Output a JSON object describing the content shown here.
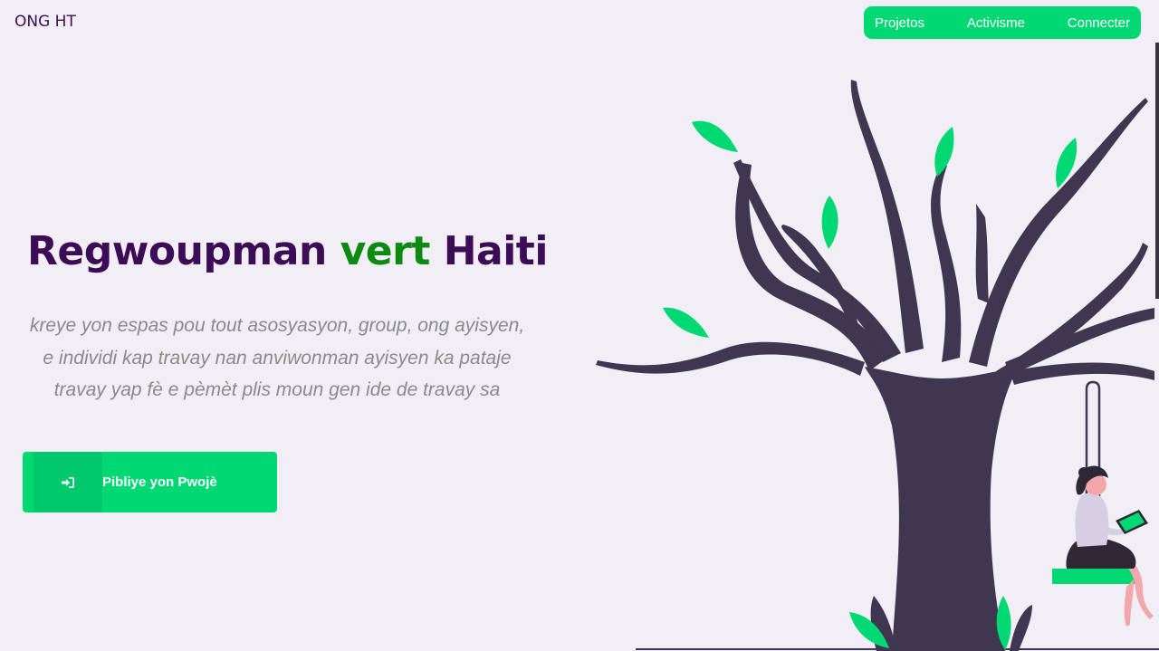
{
  "header": {
    "brand": "ONG HT",
    "nav": [
      {
        "label": "Projetos"
      },
      {
        "label": "Activisme"
      },
      {
        "label": "Connecter"
      }
    ]
  },
  "hero": {
    "title_part1": "Regwoupman ",
    "title_accent": "vert",
    "title_part2": " Haiti",
    "subtitle": "kreye yon espas pou tout asosyasyon, group, ong ayisyen, e individi kap travay nan anviwonman ayisyen ka pataje travay yap fè e pèmèt plis moun gen ide de travay sa",
    "cta_label": "Pibliye yon Pwojè",
    "cta_icon": "sign-in-icon"
  },
  "colors": {
    "background": "#f1eff5",
    "brand_text": "#3c0d56",
    "accent_green": "#00d873",
    "title_accent": "#0d8a12",
    "tree_trunk": "#3f3650",
    "leaf": "#00d873"
  }
}
